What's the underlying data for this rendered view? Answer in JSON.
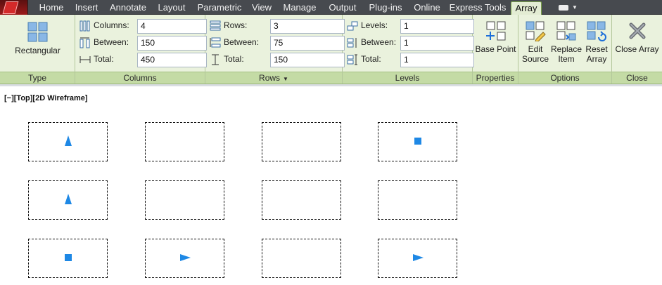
{
  "tabs": [
    {
      "label": "Home",
      "active": false
    },
    {
      "label": "Insert",
      "active": false
    },
    {
      "label": "Annotate",
      "active": false
    },
    {
      "label": "Layout",
      "active": false
    },
    {
      "label": "Parametric",
      "active": false
    },
    {
      "label": "View",
      "active": false
    },
    {
      "label": "Manage",
      "active": false
    },
    {
      "label": "Output",
      "active": false
    },
    {
      "label": "Plug-ins",
      "active": false
    },
    {
      "label": "Online",
      "active": false
    },
    {
      "label": "Express Tools",
      "active": false
    },
    {
      "label": "Array",
      "active": true
    }
  ],
  "ribbon": {
    "type_panel": {
      "title": "Type",
      "button": "Rectangular"
    },
    "columns_panel": {
      "title": "Columns",
      "columns_label": "Columns:",
      "columns_value": "4",
      "between_label": "Between:",
      "between_value": "150",
      "total_label": "Total:",
      "total_value": "450"
    },
    "rows_panel": {
      "title": "Rows",
      "rows_label": "Rows:",
      "rows_value": "3",
      "between_label": "Between:",
      "between_value": "75",
      "total_label": "Total:",
      "total_value": "150"
    },
    "levels_panel": {
      "title": "Levels",
      "levels_label": "Levels:",
      "levels_value": "1",
      "between_label": "Between:",
      "between_value": "1",
      "total_label": "Total:",
      "total_value": "1"
    },
    "properties_panel": {
      "title": "Properties",
      "base_point": "Base Point"
    },
    "options_panel": {
      "title": "Options",
      "edit_source_1": "Edit",
      "edit_source_2": "Source",
      "replace_item_1": "Replace",
      "replace_item_2": "Item",
      "reset_array_1": "Reset",
      "reset_array_2": "Array"
    },
    "close_panel": {
      "title": "Close",
      "close_array": "Close Array"
    }
  },
  "viewport": {
    "label": "[−][Top][2D Wireframe]"
  },
  "array_grid": {
    "rows": [
      [
        "triangle-up",
        "empty",
        "empty",
        "square"
      ],
      [
        "triangle-up",
        "empty",
        "empty",
        "empty"
      ],
      [
        "square",
        "triangle-right",
        "empty",
        "triangle-right"
      ]
    ],
    "item_color": "#1e88e5"
  },
  "colors": {
    "tabbar": "#474a4f",
    "ribbon": "#eaf2dd",
    "panel_title": "#c4dba5",
    "active_tab": "#e3ecd3"
  }
}
